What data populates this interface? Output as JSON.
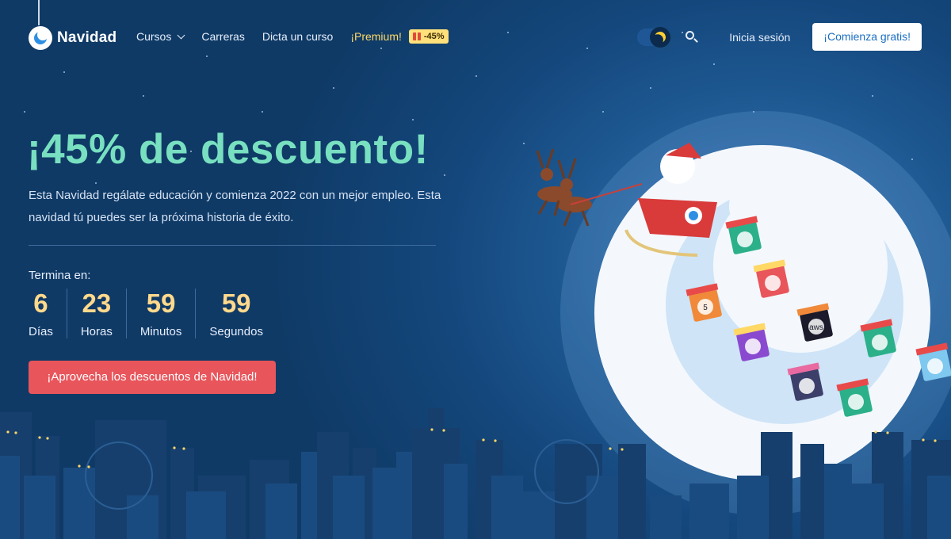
{
  "header": {
    "logo_text": "Navidad",
    "nav": {
      "courses": "Cursos",
      "careers": "Carreras",
      "teach": "Dicta un curso",
      "premium": "¡Premium!",
      "premium_badge": "-45%"
    },
    "login": "Inicia sesión",
    "cta": "¡Comienza gratis!"
  },
  "hero": {
    "title": "¡45% de descuento!",
    "description": "Esta Navidad regálate educación y comienza 2022 con un mejor empleo. Esta navidad tú puedes ser la próxima historia de éxito.",
    "countdown_label": "Termina en:",
    "countdown": [
      {
        "value": "6",
        "label": "Días"
      },
      {
        "value": "23",
        "label": "Horas"
      },
      {
        "value": "59",
        "label": "Minutos"
      },
      {
        "value": "59",
        "label": "Segundos"
      }
    ],
    "cta": "¡Aprovecha los descuentos de Navidad!"
  },
  "illustration": {
    "gift_icons": [
      "gift-android-icon",
      "gift-angular-icon",
      "gift-html5-icon",
      "gift-aws-icon",
      "gift-tensorflow-icon",
      "gift-vue-icon",
      "gift-react-icon",
      "gift-swift-icon",
      "gift-figma-icon"
    ],
    "gift_labels": {
      "html5": "5",
      "aws": "aws"
    }
  },
  "colors": {
    "background": "#0f3a66",
    "title_accent": "#78e0c0",
    "countdown_value": "#ffd98c",
    "premium": "#ffd866",
    "cta_main": "#e8555b",
    "cta_top_text": "#1b6ec2"
  }
}
